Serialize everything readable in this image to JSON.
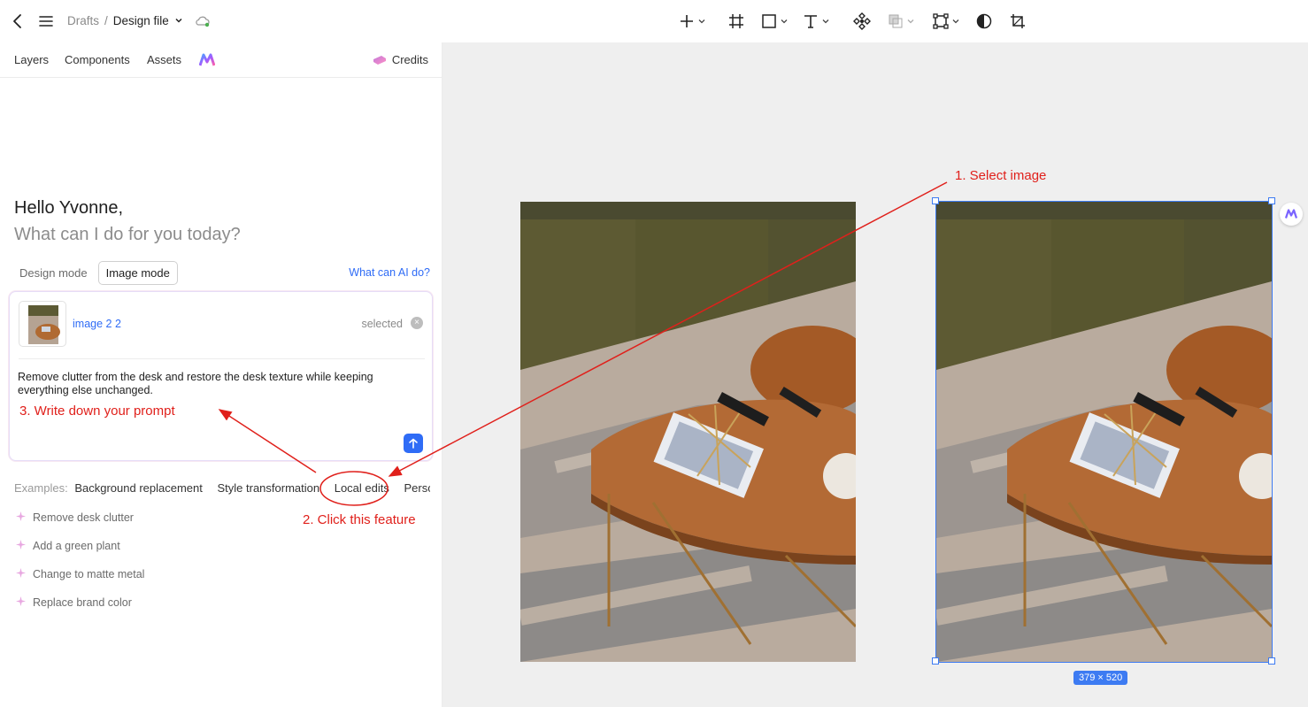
{
  "topbar": {
    "breadcrumb_root": "Drafts",
    "breadcrumb_sep": "/",
    "file_name": "Design file",
    "icons": [
      "back-arrow-icon",
      "menu-icon",
      "cloud-sync-icon",
      "plus-icon",
      "frame-icon",
      "rectangle-icon",
      "text-icon",
      "component-icon",
      "boolean-icon",
      "vector-icon",
      "contrast-icon",
      "crop-icon"
    ]
  },
  "panel": {
    "tabs": [
      "Layers",
      "Components",
      "Assets"
    ],
    "credits_label": "Credits",
    "greeting": "Hello Yvonne,",
    "question": "What can I do for you today?",
    "modes": [
      "Design mode",
      "Image mode"
    ],
    "active_mode": "Image mode",
    "what_ai_link": "What can AI do?",
    "attachment": {
      "name": "image 2 2",
      "status": "selected"
    },
    "prompt_text": "Remove clutter from the desk and restore the desk texture while keeping everything else unchanged.",
    "examples_label": "Examples:",
    "examples": [
      "Background replacement",
      "Style transformation",
      "Local edits",
      "Persor"
    ],
    "suggestions": [
      "Remove desk clutter",
      "Add a green plant",
      "Change to matte metal",
      "Replace brand color"
    ]
  },
  "canvas": {
    "dimension_badge": "379 × 520"
  },
  "annotations": {
    "step1": "1. Select image",
    "step2": "2. Click this feature",
    "step3": "3. Write down your prompt"
  },
  "colors": {
    "accent": "#2f6cf6",
    "annotation": "#e0201b",
    "canvas_bg": "#efefef"
  }
}
